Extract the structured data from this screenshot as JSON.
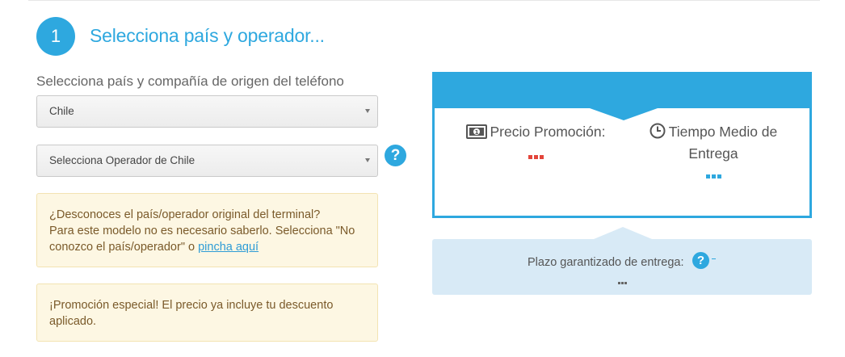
{
  "step": {
    "number": "1",
    "title": "Selecciona país y operador..."
  },
  "origin": {
    "label": "Selecciona país y compañía de origen del teléfono",
    "country_value": "Chile",
    "operator_value": "Selecciona Operador de Chile",
    "help_symbol": "?"
  },
  "notes": {
    "unknown_line1": "¿Desconoces el país/operador original del terminal?",
    "unknown_line2": "Para este modelo no es necesario saberlo. Selecciona \"No conozco el país/operador\" o ",
    "unknown_link": "pincha aquí",
    "promo": "¡Promoción especial! El precio ya incluye tu descuento aplicado."
  },
  "summary": {
    "price_label": "Precio Promoción:",
    "time_label": "Tiempo Medio de Entrega",
    "price_icon": "money-icon",
    "time_icon": "clock-icon"
  },
  "delivery": {
    "label": "Plazo garantizado de entrega:",
    "help_symbol": "?"
  },
  "colors": {
    "accent": "#2ea8df",
    "price_dots": "#e3453b",
    "note_bg": "#fdf7e3",
    "delivery_bg": "#d8eaf6"
  }
}
